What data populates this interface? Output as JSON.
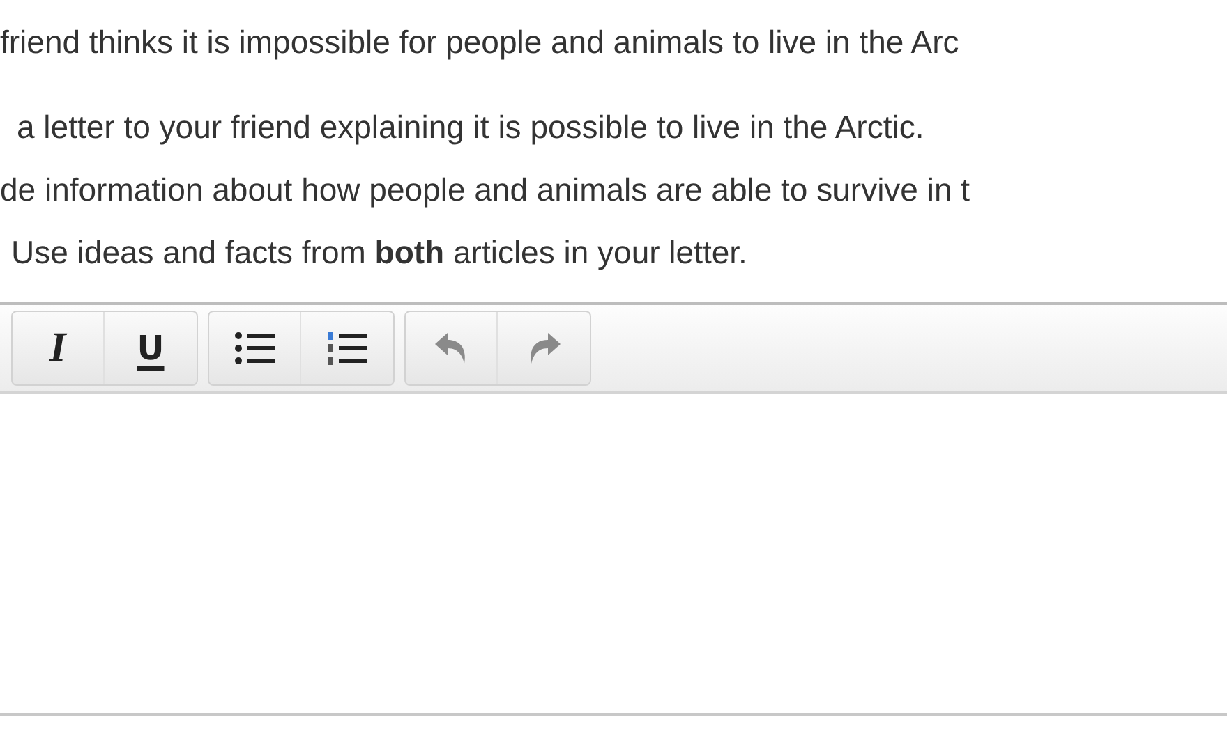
{
  "prompt": {
    "lines": [
      "friend thinks it is impossible for people and animals to live in the Arc",
      "a letter to your friend explaining it is possible to live in the Arctic.",
      "de information about how people and animals are able to survive in t",
      "Use ideas and facts from **both** articles in your letter."
    ]
  },
  "toolbar": {
    "groups": [
      [
        {
          "kind": "italic",
          "label": "I"
        },
        {
          "kind": "underline",
          "label": "U"
        }
      ],
      [
        {
          "kind": "bullet-list"
        },
        {
          "kind": "numbered-list"
        }
      ],
      [
        {
          "kind": "undo"
        },
        {
          "kind": "redo"
        }
      ]
    ]
  }
}
